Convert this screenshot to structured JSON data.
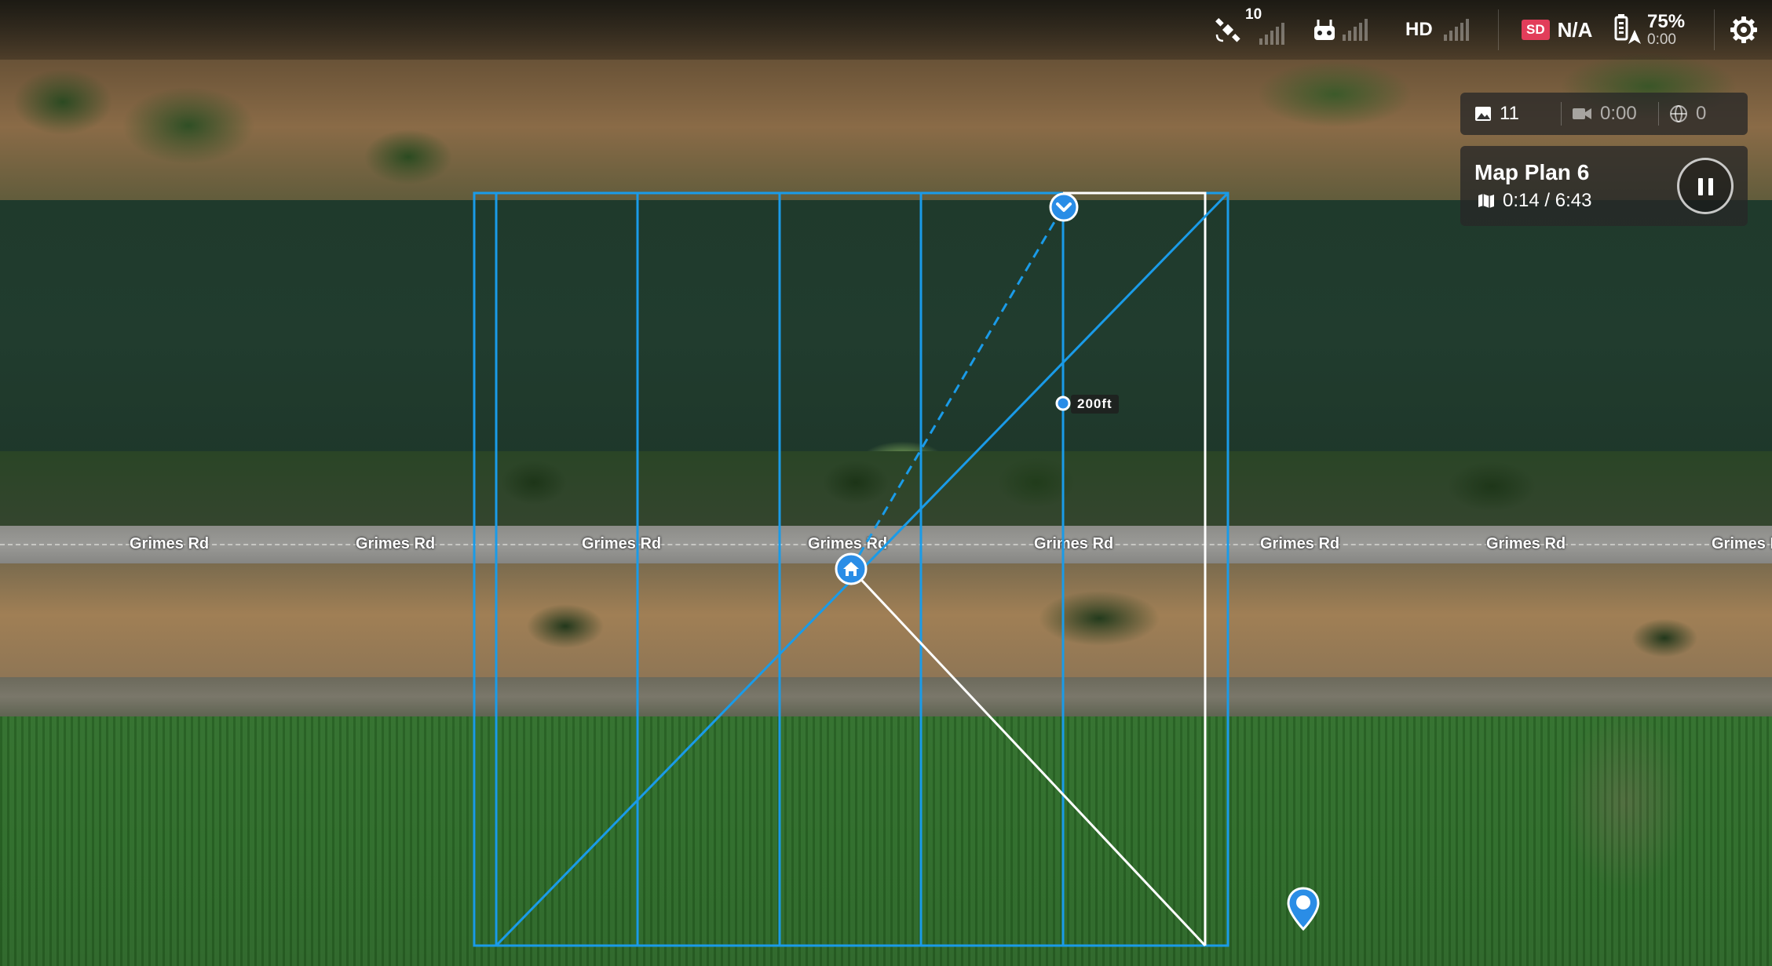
{
  "status_bar": {
    "satellite_count": "10",
    "video_quality": "HD",
    "sd_label": "SD",
    "sd_status": "N/A",
    "battery_percent": "75%",
    "battery_time": "0:00"
  },
  "media_counts": {
    "photos": "11",
    "video_time": "0:00",
    "panoramas": "0"
  },
  "mission": {
    "name": "Map Plan 6",
    "progress": "0:14 / 6:43"
  },
  "map": {
    "road_name": "Grimes Rd",
    "road_labels": [
      "Grimes Rd",
      "Grimes Rd",
      "Grimes Rd",
      "Grimes Rd",
      "Grimes Rd",
      "Grimes Rd",
      "Grimes Rd",
      "Grimes Rd"
    ],
    "altitude_label": "200ft"
  },
  "colors": {
    "flight_path": "#1a9be8",
    "sd_badge": "#e23d5a",
    "marker": "#2a8de6"
  },
  "icons": {
    "satellite": "satellite-icon",
    "remote": "remote-controller-icon",
    "battery": "battery-icon",
    "settings": "gear-icon",
    "photo": "photo-icon",
    "video": "video-camera-icon",
    "panorama": "globe-icon",
    "map": "map-icon",
    "pause": "pause-icon",
    "home": "home-icon",
    "waypoint": "chevron-down-icon",
    "location": "location-pin-icon"
  }
}
